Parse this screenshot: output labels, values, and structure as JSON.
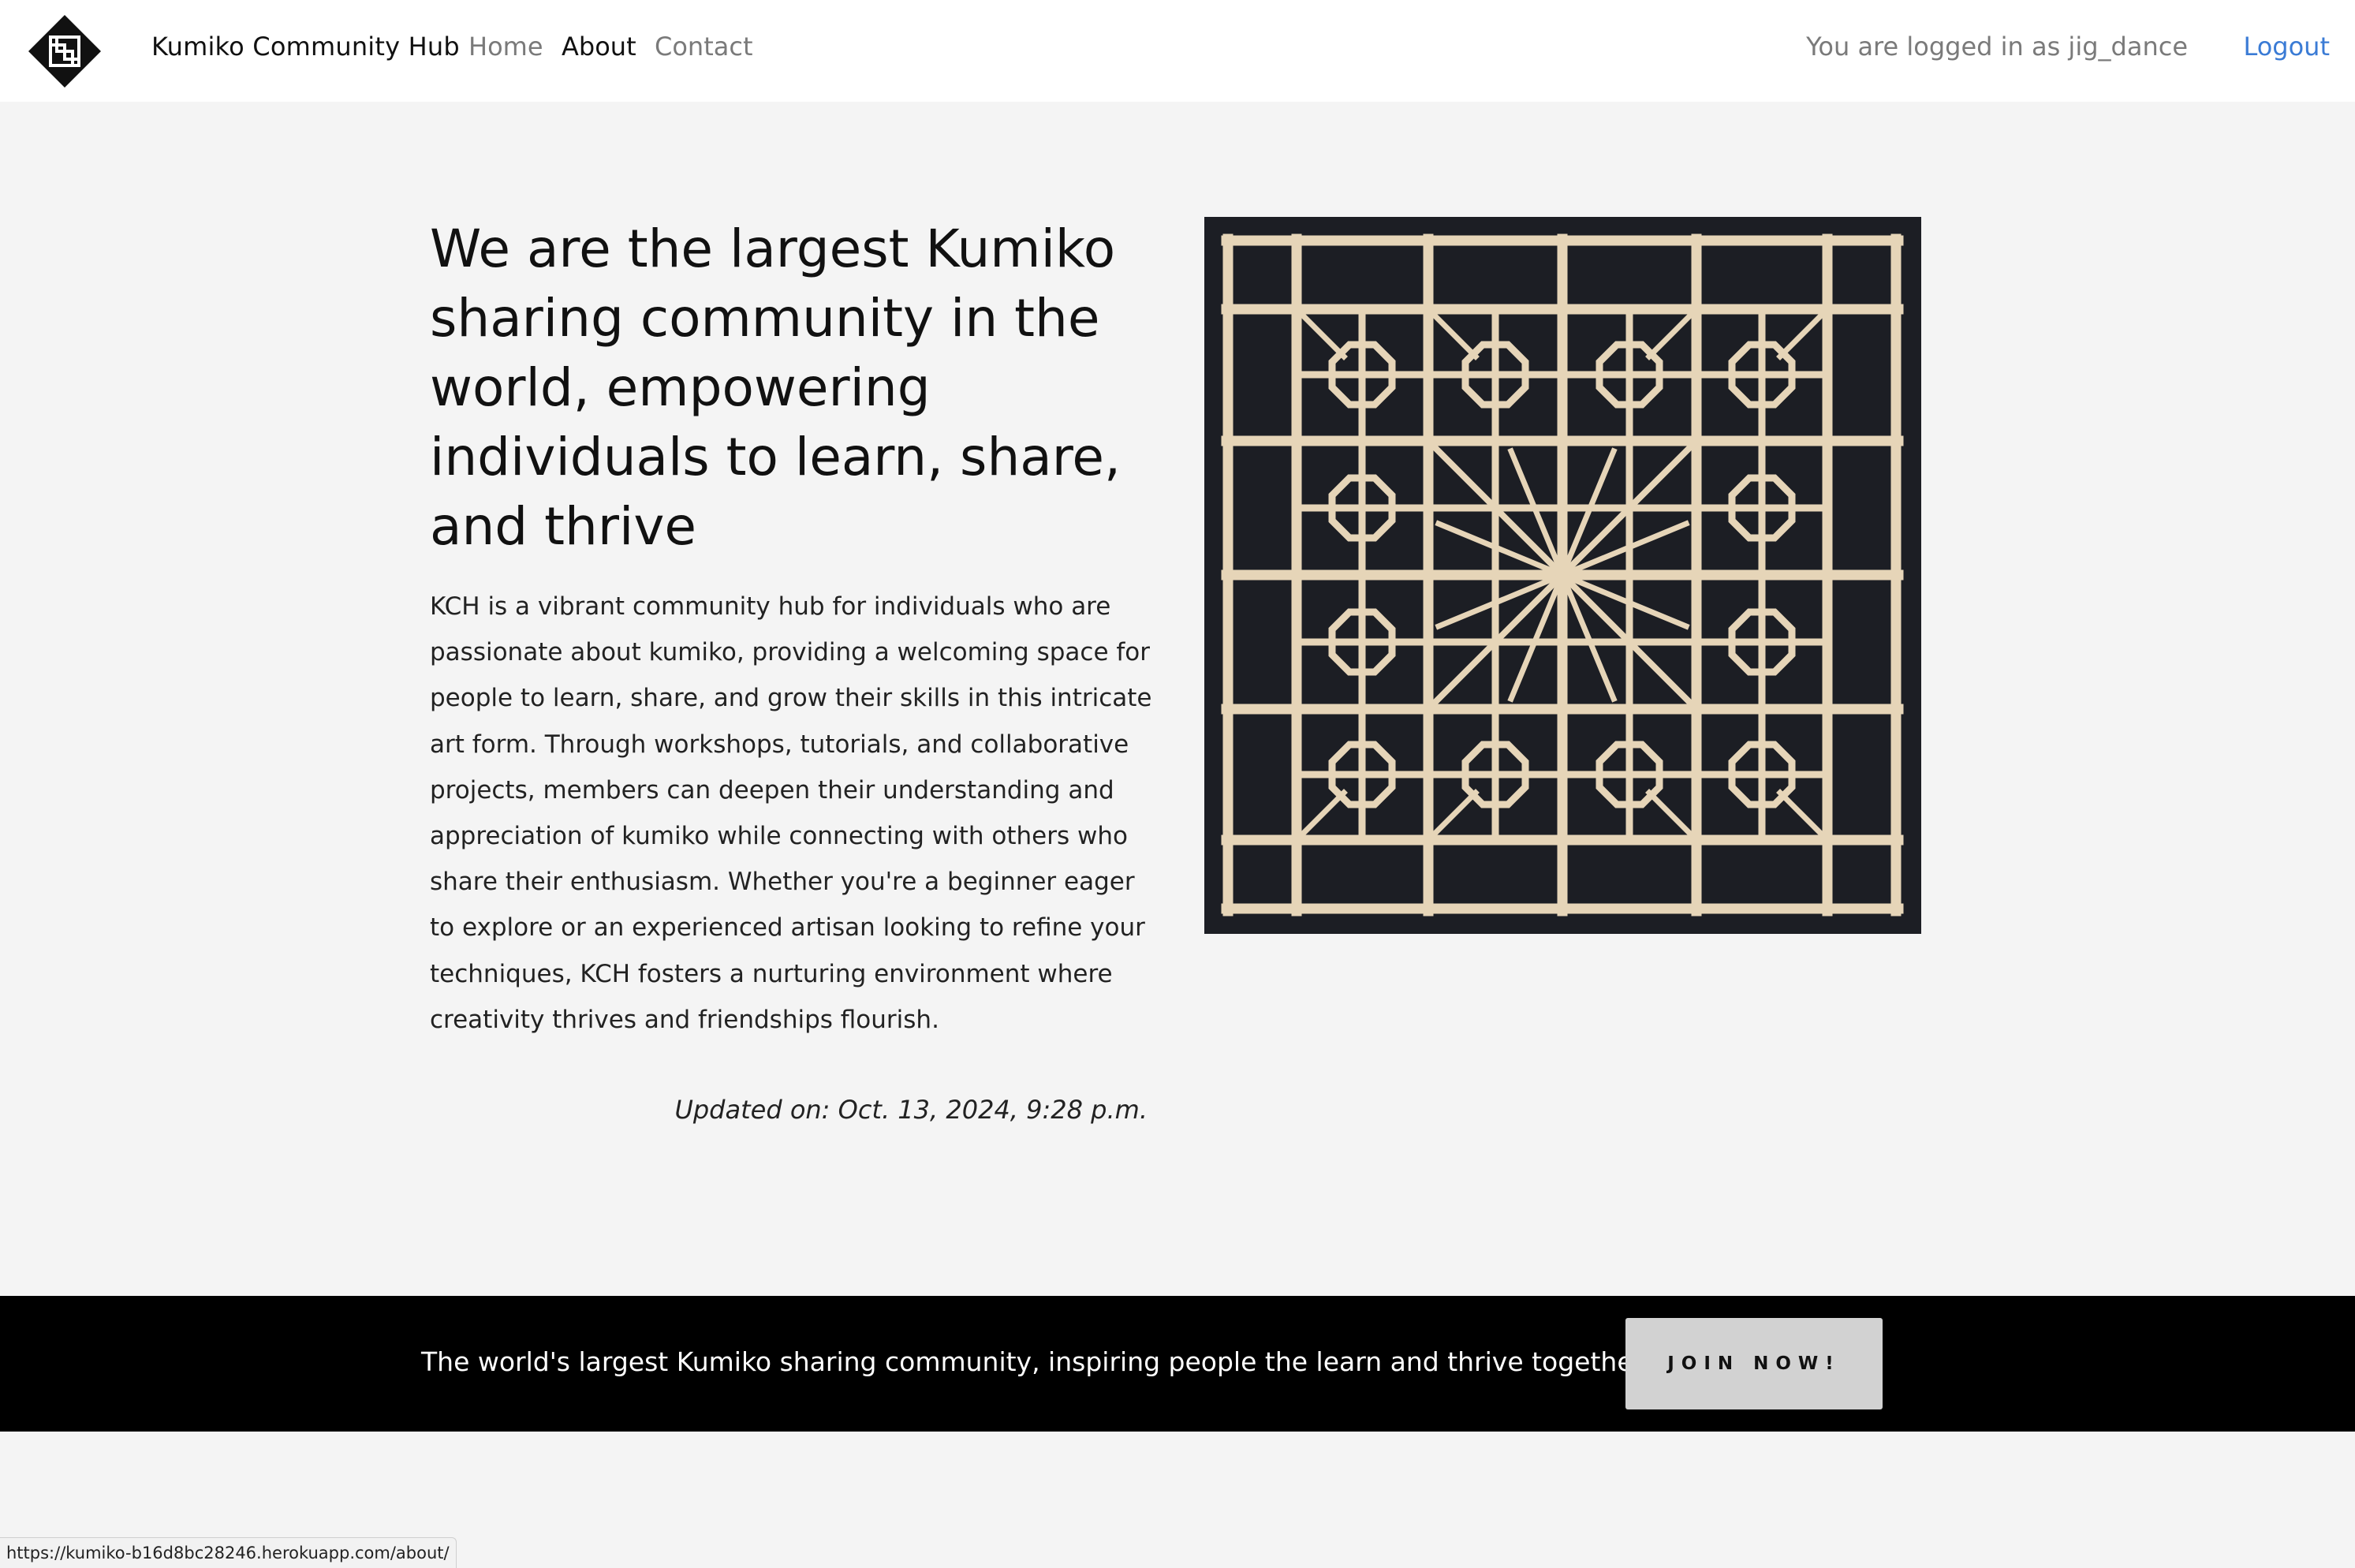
{
  "nav": {
    "brand": "Kumiko Community Hub",
    "links": [
      "Home",
      "About",
      "Contact"
    ],
    "active": "About",
    "login_text": "You are logged in as jig_dance",
    "logout": "Logout"
  },
  "main": {
    "headline": "We are the largest Kumiko sharing community in the world, empowering individuals to learn, share, and thrive",
    "body": "KCH is a vibrant community hub for individuals who are passionate about kumiko, providing a welcoming space for people to learn, share, and grow their skills in this intricate art form. Through workshops, tutorials, and collaborative projects, members can deepen their understanding and appreciation of kumiko while connecting with others who share their enthusiasm. Whether you're a beginner eager to explore or an experienced artisan looking to refine your techniques, KCH fosters a nurturing environment where creativity thrives and friendships flourish.",
    "updated": "Updated on: Oct. 13, 2024, 9:28 p.m.",
    "image_icon": "kumiko-lattice-panel"
  },
  "banner": {
    "text": "The world's largest Kumiko sharing community, inspiring people the learn and thrive together",
    "button": "JOIN NOW!"
  },
  "status_url": "https://kumiko-b16d8bc28246.herokuapp.com/about/",
  "colors": {
    "accent_link": "#3a7bd5",
    "banner_bg": "#000000",
    "page_bg": "#f4f4f4",
    "button_bg": "#d2d2d2",
    "wood": "#e6d5b8"
  }
}
